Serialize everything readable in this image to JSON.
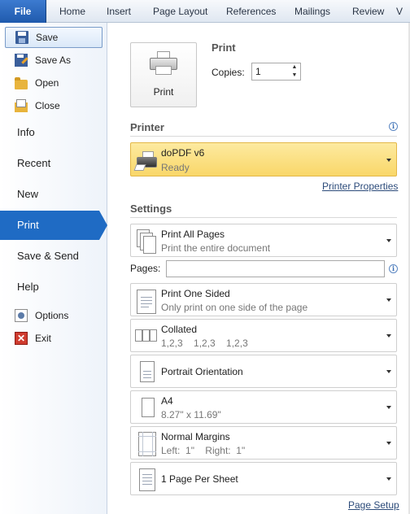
{
  "ribbon": {
    "tabs": [
      "File",
      "Home",
      "Insert",
      "Page Layout",
      "References",
      "Mailings",
      "Review",
      "V"
    ]
  },
  "nav": {
    "small_top": [
      {
        "label": "Save",
        "icon": "save-icon"
      },
      {
        "label": "Save As",
        "icon": "save-as-icon"
      },
      {
        "label": "Open",
        "icon": "open-folder-icon"
      },
      {
        "label": "Close",
        "icon": "close-folder-icon"
      }
    ],
    "info": "Info",
    "recent": "Recent",
    "new": "New",
    "print": "Print",
    "save_send": "Save & Send",
    "help": "Help",
    "options": "Options",
    "exit": "Exit",
    "exit_glyph": "✕"
  },
  "print": {
    "heading": "Print",
    "button_label": "Print",
    "copies_label": "Copies:",
    "copies_value": "1",
    "spin_up": "▲",
    "spin_down": "▼"
  },
  "printer": {
    "heading": "Printer",
    "name": "doPDF v6",
    "status": "Ready",
    "properties_link": "Printer Properties"
  },
  "settings": {
    "heading": "Settings",
    "pages_label": "Pages:",
    "pages_value": "",
    "items": [
      {
        "title": "Print All Pages",
        "subtitle": "Print the entire document"
      },
      {
        "title": "Print One Sided",
        "subtitle": "Only print on one side of the page"
      },
      {
        "title": "Collated",
        "subtitle": "1,2,3    1,2,3    1,2,3"
      },
      {
        "title": "Portrait Orientation",
        "subtitle": ""
      },
      {
        "title": "A4",
        "subtitle": "8.27\" x 11.69\""
      },
      {
        "title": "Normal Margins",
        "subtitle": "Left:  1\"    Right:  1\""
      },
      {
        "title": "1 Page Per Sheet",
        "subtitle": ""
      }
    ],
    "page_setup_link": "Page Setup"
  },
  "info_glyph": "i",
  "colors": {
    "file_tab": "#1f5aad",
    "nav_active": "#1f6bc4",
    "printer_highlight": "#f9d769"
  }
}
